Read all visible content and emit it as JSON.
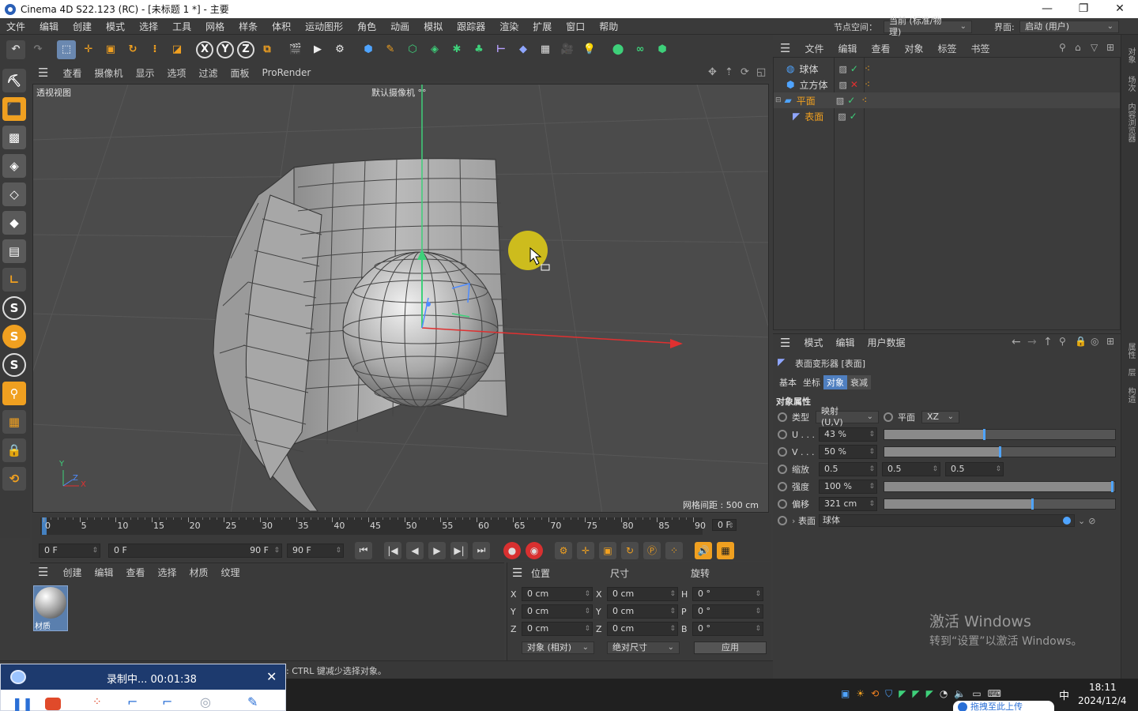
{
  "window": {
    "title": "Cinema 4D S22.123 (RC) - [未标题 1 *] - 主要",
    "minimize": "—",
    "restore": "❐",
    "close": "✕"
  },
  "menubar": {
    "items": [
      "文件",
      "编辑",
      "创建",
      "模式",
      "选择",
      "工具",
      "网格",
      "样条",
      "体积",
      "运动图形",
      "角色",
      "动画",
      "模拟",
      "跟踪器",
      "渲染",
      "扩展",
      "窗口",
      "帮助"
    ],
    "node_space_label": "节点空间：",
    "node_space_value": "当前 (标准/物理)",
    "layout_label": "界面:",
    "layout_value": "启动 (用户)"
  },
  "viewport": {
    "menu": [
      "查看",
      "摄像机",
      "显示",
      "选项",
      "过滤",
      "面板",
      "ProRender"
    ],
    "label": "透视视图",
    "camera": "默认摄像机 °°",
    "grid_spacing": "网格间距 : 500 cm",
    "axis_x": "X",
    "axis_y": "Y",
    "axis_z": "Z"
  },
  "timeline": {
    "ticks": [
      "0",
      "5",
      "10",
      "15",
      "20",
      "25",
      "30",
      "35",
      "40",
      "45",
      "50",
      "55",
      "60",
      "65",
      "70",
      "75",
      "80",
      "85",
      "90"
    ],
    "current_frame_display": "0 F",
    "start": "0 F",
    "preview_start": "0 F",
    "preview_end": "90 F",
    "end": "90 F"
  },
  "materials": {
    "menu": [
      "创建",
      "编辑",
      "查看",
      "选择",
      "材质",
      "纹理"
    ],
    "items": [
      {
        "label": "材质"
      }
    ]
  },
  "coordinates": {
    "headers": {
      "position": "位置",
      "size": "尺寸",
      "rotation": "旋转"
    },
    "rows": [
      {
        "axis": "X",
        "pos": "0 cm",
        "size_axis": "X",
        "size": "0 cm",
        "rot_axis": "H",
        "rot": "0 °"
      },
      {
        "axis": "Y",
        "pos": "0 cm",
        "size_axis": "Y",
        "size": "0 cm",
        "rot_axis": "P",
        "rot": "0 °"
      },
      {
        "axis": "Z",
        "pos": "0 cm",
        "size_axis": "Z",
        "size": "0 cm",
        "rot_axis": "B",
        "rot": "0 °"
      }
    ],
    "mode": "对象 (相对)",
    "size_mode": "绝对尺寸",
    "apply": "应用"
  },
  "status": {
    "text": ": CTRL 键减少选择对象。"
  },
  "objects": {
    "menu": [
      "文件",
      "编辑",
      "查看",
      "对象",
      "标签",
      "书签"
    ],
    "tree": [
      {
        "name": "球体",
        "state": "check",
        "highlight": false
      },
      {
        "name": "立方体",
        "state": "cross",
        "highlight": false
      },
      {
        "name": "平面",
        "state": "check",
        "highlight": true
      },
      {
        "name": "表面",
        "state": "check",
        "highlight": true
      }
    ]
  },
  "attributes": {
    "menu": [
      "模式",
      "编辑",
      "用户数据"
    ],
    "object_title": "表面变形器 [表面]",
    "tabs": [
      "基本",
      "坐标",
      "对象",
      "衰减"
    ],
    "active_tab": "对象",
    "section": "对象属性",
    "type_label": "类型",
    "type_value": "映射 (U,V)",
    "plane_label": "平面",
    "plane_value": "XZ",
    "u_label": "U . . .",
    "u_value": "43 %",
    "u_fraction": 0.43,
    "v_label": "V . . .",
    "v_value": "50 %",
    "v_fraction": 0.5,
    "scale_label": "缩放",
    "scale_values": [
      "0.5",
      "0.5",
      "0.5"
    ],
    "strength_label": "强度",
    "strength_value": "100 %",
    "strength_fraction": 1.0,
    "offset_label": "偏移",
    "offset_value": "321 cm",
    "offset_fraction": 0.64,
    "surface_label": "表面",
    "surface_value": "球体"
  },
  "right_strip": {
    "tabs": [
      "对象",
      "场次",
      "内容浏览器",
      "属性",
      "层",
      "构造"
    ]
  },
  "watermark": {
    "line1": "激活 Windows",
    "line2": "转到“设置”以激活 Windows。"
  },
  "recorder": {
    "status": "录制中... 00:01:38"
  },
  "taskbar": {
    "ime": "中",
    "time": "18:11",
    "date": "2024/12/4",
    "popup": "拖拽至此上传"
  }
}
